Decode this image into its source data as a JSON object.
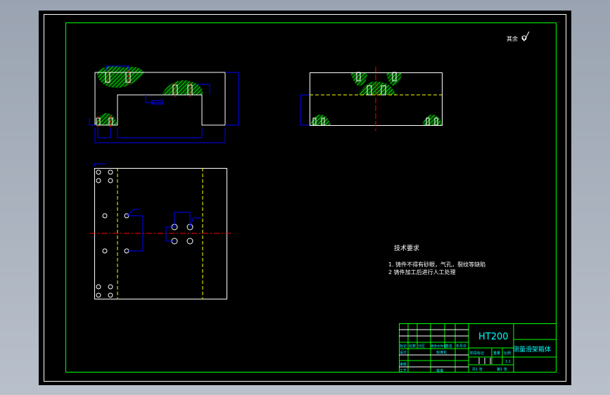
{
  "drawing": {
    "roughness_note": "其余",
    "tech_req": {
      "title": "技术要求",
      "items": [
        "1. 铸件不得有砂眼，气孔，裂纹等缺陷",
        "2 铸件加工后进行人工处理"
      ]
    },
    "title_block": {
      "material": "HT200",
      "part_name": "测量滑架箱体",
      "headers": [
        "标记",
        "处数",
        "分区",
        "更改文件号",
        "签名",
        "年月日"
      ],
      "design": "设计",
      "standardization": "标准化",
      "review": "审核",
      "process": "工艺",
      "approve": "批准",
      "stage_mark": "阶段标记",
      "weight": "重量",
      "scale_label": "比例",
      "scale": "1:1",
      "total_sheets": "共1 张",
      "sheet_no": "第1 张"
    }
  },
  "colors": {
    "outline": "#ffffff",
    "dimension": "#0000ff",
    "center": "#ff0000",
    "hidden": "#ffff00",
    "hatch": "#00ff00",
    "text": "#00ffff"
  }
}
